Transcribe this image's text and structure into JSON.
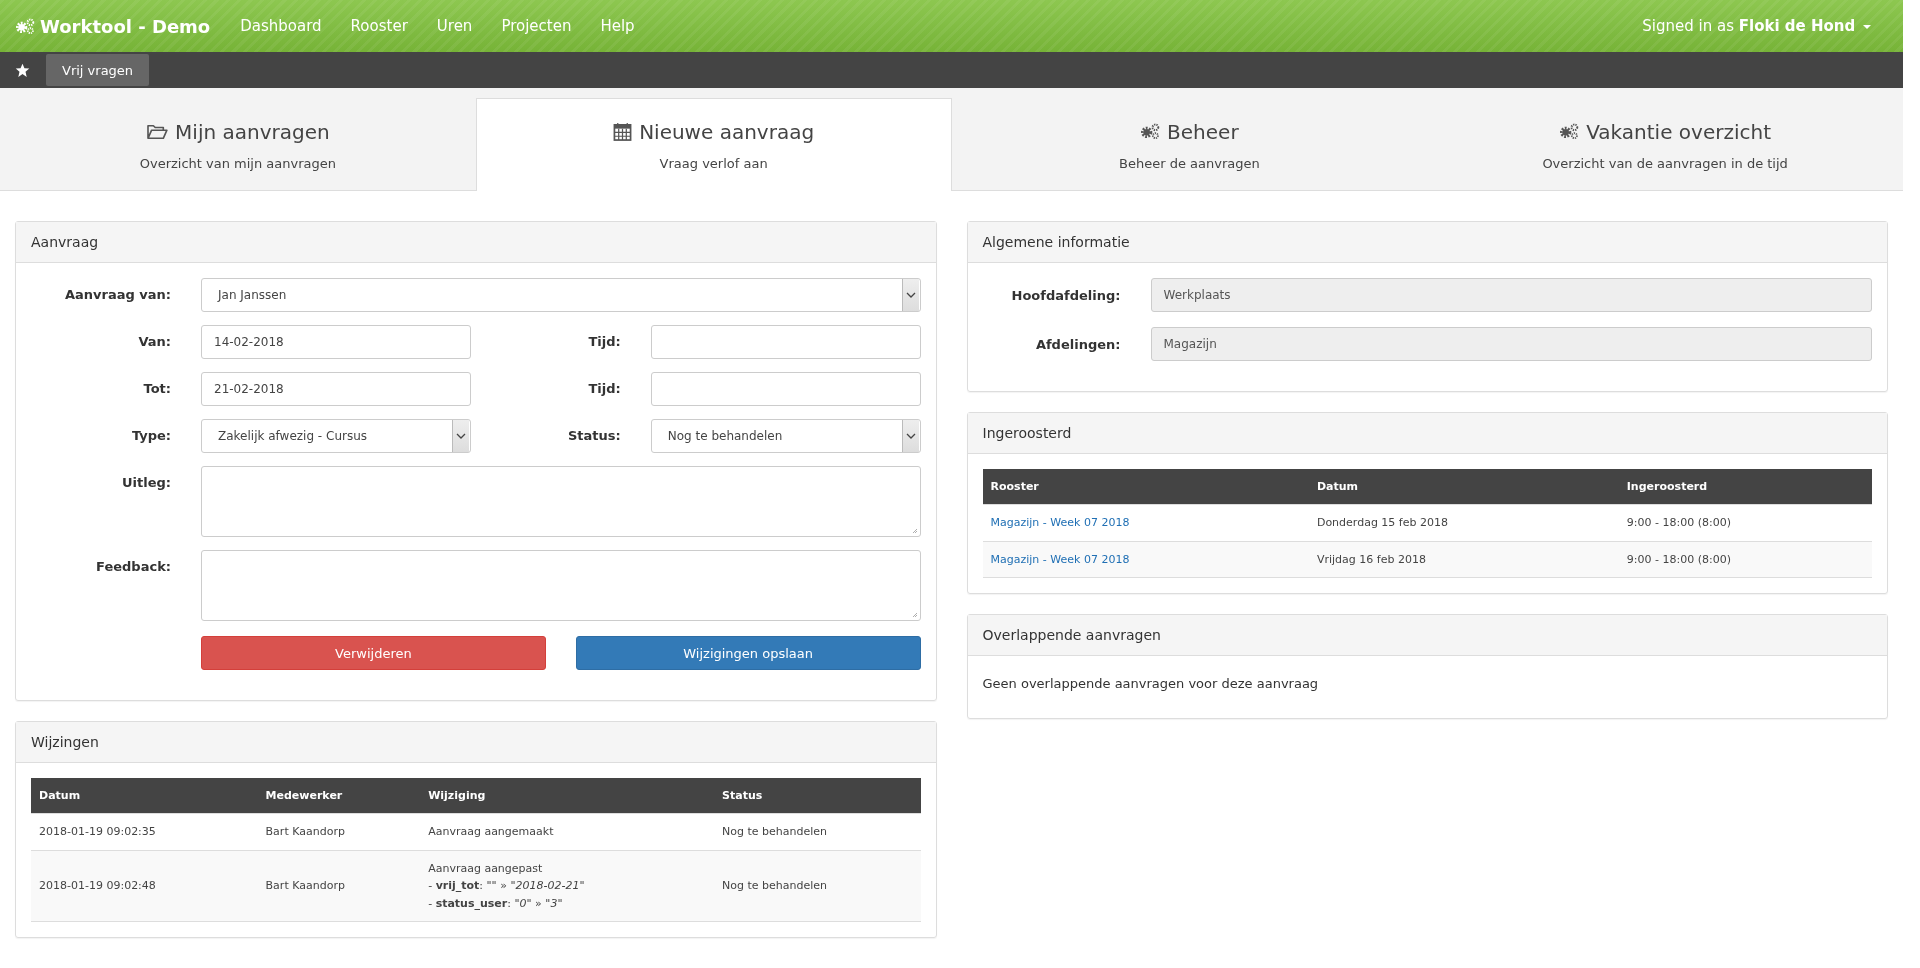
{
  "navbar": {
    "brand": "Worktool - Demo",
    "links": [
      "Dashboard",
      "Rooster",
      "Uren",
      "Projecten",
      "Help"
    ],
    "user": {
      "prefix": "Signed in as",
      "name": "Floki de Hond"
    }
  },
  "subbar": {
    "button": "Vrij vragen"
  },
  "tabs": [
    {
      "title": "Mijn aanvragen",
      "subtitle": "Overzicht van mijn aanvragen",
      "selected": false
    },
    {
      "title": "Nieuwe aanvraag",
      "subtitle": "Vraag verlof aan",
      "selected": true
    },
    {
      "title": "Beheer",
      "subtitle": "Beheer de aanvragen",
      "selected": false
    },
    {
      "title": "Vakantie overzicht",
      "subtitle": "Overzicht van de aanvragen in de tijd",
      "selected": false
    }
  ],
  "request_panel": {
    "title": "Aanvraag",
    "rows": [
      {
        "fields": [
          {
            "label": "Aanvraag van:",
            "kind": "select",
            "value": "Jan Janssen"
          }
        ]
      },
      {
        "fields": [
          {
            "label": "Van:",
            "kind": "input",
            "value": "14-02-2018"
          },
          {
            "label": "Tijd:",
            "kind": "input"
          }
        ]
      },
      {
        "fields": [
          {
            "label": "Tot:",
            "kind": "input",
            "value": "21-02-2018"
          },
          {
            "label": "Tijd:",
            "kind": "input"
          }
        ]
      },
      {
        "fields": [
          {
            "label": "Type:",
            "kind": "select",
            "value": "Zakelijk afwezig - Cursus"
          },
          {
            "label": "Status:",
            "kind": "select",
            "value": "Nog te behandelen"
          }
        ]
      },
      {
        "fields": [
          {
            "label": "Uitleg:",
            "kind": "textarea"
          }
        ]
      },
      {
        "fields": [
          {
            "label": "Feedback:",
            "kind": "textarea"
          }
        ]
      }
    ],
    "buttons": [
      {
        "label": "Verwijderen",
        "kind": "danger"
      },
      {
        "label": "Wijzigingen opslaan",
        "kind": "primary"
      }
    ]
  },
  "changes_panel": {
    "title": "Wijzingen",
    "columns": [
      "Datum",
      "Medewerker",
      "Wijziging",
      "Status"
    ],
    "rows": [
      {
        "date": "2018-01-19 09:02:35",
        "employee": "Bart Kaandorp",
        "change": [
          "Aanvraag aangemaakt"
        ],
        "status": "Nog te behandelen"
      },
      {
        "date": "2018-01-19 09:02:48",
        "employee": "Bart Kaandorp",
        "change": [
          "Aanvraag aangepast",
          "- **vrij_tot**: *\"\"* » *\"2018-02-21\"*",
          "- **status_user**: *\"0\"* » *\"3\"*"
        ],
        "status": "Nog te behandelen"
      }
    ]
  },
  "info_panel": {
    "title": "Algemene informatie",
    "fields": [
      {
        "label": "Hoofdafdeling:",
        "value": "Werkplaats"
      },
      {
        "label": "Afdelingen:",
        "value": "Magazijn"
      }
    ]
  },
  "schedule_panel": {
    "title": "Ingeroosterd",
    "columns": [
      "Rooster",
      "Datum",
      "Ingeroosterd"
    ],
    "rows": [
      {
        "rooster": "Magazijn - Week 07 2018",
        "date": "Donderdag 15 feb 2018",
        "time": "9:00 - 18:00 (8:00)"
      },
      {
        "rooster": "Magazijn - Week 07 2018",
        "date": "Vrijdag 16 feb 2018",
        "time": "9:00 - 18:00 (8:00)"
      }
    ]
  },
  "overlap_panel": {
    "title": "Overlappende aanvragen",
    "text": "Geen overlappende aanvragen voor deze aanvraag"
  }
}
